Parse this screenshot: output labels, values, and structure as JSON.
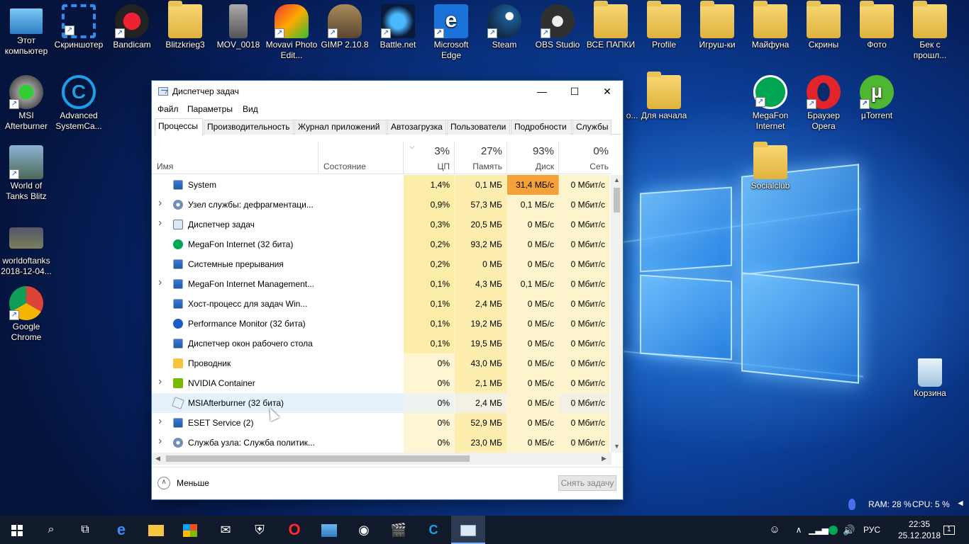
{
  "desktop": {
    "icons_top": [
      {
        "label": "Этот компьютер",
        "icon": "computer-icon"
      },
      {
        "label": "Скриншотер",
        "icon": "screenshot-icon"
      },
      {
        "label": "Bandicam",
        "icon": "bandicam-icon"
      },
      {
        "label": "Blitzkrieg3",
        "icon": "folder-icon"
      },
      {
        "label": "MOV_0018",
        "icon": "video-icon"
      },
      {
        "label": "Movavi Photo Edit...",
        "icon": "movavi-icon"
      },
      {
        "label": "GIMP 2.10.8",
        "icon": "gimp-icon"
      },
      {
        "label": "Battle.net",
        "icon": "battlenet-icon"
      },
      {
        "label": "Microsoft Edge",
        "icon": "edge-icon"
      },
      {
        "label": "Steam",
        "icon": "steam-icon"
      },
      {
        "label": "OBS Studio",
        "icon": "obs-icon"
      },
      {
        "label": "ВСЕ ПАПКИ",
        "icon": "folder-icon"
      },
      {
        "label": "Profile",
        "icon": "folder-icon"
      },
      {
        "label": "Игруш-ки",
        "icon": "folder-icon"
      },
      {
        "label": "Майфуна",
        "icon": "folder-icon"
      },
      {
        "label": "Скрины",
        "icon": "folder-icon"
      },
      {
        "label": "Фото",
        "icon": "folder-icon"
      },
      {
        "label": "Бек с прошл...",
        "icon": "folder-icon"
      }
    ],
    "icons_left": [
      {
        "label": "MSI Afterburner",
        "icon": "msi-afterburner-icon"
      },
      {
        "label": "World of Tanks Blitz",
        "icon": "wot-blitz-icon"
      },
      {
        "label": "worldoftanks 2018-12-04...",
        "icon": "video-icon"
      },
      {
        "label": "Google Chrome",
        "icon": "chrome-icon"
      }
    ],
    "icon_advanced": {
      "label": "Advanced SystemCa...",
      "icon": "advanced-systemcare-icon"
    },
    "icon_partial": {
      "label": "ита о...",
      "icon": "app-icon"
    },
    "icon_dlya_nachala": {
      "label": "Для начала",
      "icon": "folder-icon"
    },
    "icons_right": [
      {
        "label": "MegaFon Internet",
        "icon": "megafon-icon"
      },
      {
        "label": "Браузер Opera",
        "icon": "opera-icon"
      },
      {
        "label": "µTorrent",
        "icon": "utorrent-icon"
      }
    ],
    "icon_socialclub": {
      "label": "Socialclub",
      "icon": "folder-icon"
    },
    "icon_recycle": {
      "label": "Корзина",
      "icon": "recycle-bin-icon"
    }
  },
  "taskmanager": {
    "title": "Диспетчер задач",
    "menu": [
      "Файл",
      "Параметры",
      "Вид"
    ],
    "tabs": [
      "Процессы",
      "Производительность",
      "Журнал приложений",
      "Автозагрузка",
      "Пользователи",
      "Подробности",
      "Службы"
    ],
    "columns": {
      "name": "Имя",
      "status": "Состояние",
      "cpu": {
        "pct": "3%",
        "label": "ЦП"
      },
      "mem": {
        "pct": "27%",
        "label": "Память"
      },
      "disk": {
        "pct": "93%",
        "label": "Диск"
      },
      "net": {
        "pct": "0%",
        "label": "Сеть"
      }
    },
    "rows": [
      {
        "name": "System",
        "expand": false,
        "cpu": "1,4%",
        "mem": "0,1 МБ",
        "disk": "31,4 МБ/с",
        "net": "0 Мбит/с",
        "icon": "system-icon"
      },
      {
        "name": "Узел службы: дефрагментаци...",
        "expand": true,
        "cpu": "0,9%",
        "mem": "57,3 МБ",
        "disk": "0,1 МБ/с",
        "net": "0 Мбит/с",
        "icon": "gear-icon"
      },
      {
        "name": "Диспетчер задач",
        "expand": true,
        "cpu": "0,3%",
        "mem": "20,5 МБ",
        "disk": "0 МБ/с",
        "net": "0 Мбит/с",
        "icon": "taskmgr-icon"
      },
      {
        "name": "MegaFon Internet (32 бита)",
        "expand": false,
        "cpu": "0,2%",
        "mem": "93,2 МБ",
        "disk": "0 МБ/с",
        "net": "0 Мбит/с",
        "icon": "megafon-icon"
      },
      {
        "name": "Системные прерывания",
        "expand": false,
        "cpu": "0,2%",
        "mem": "0 МБ",
        "disk": "0 МБ/с",
        "net": "0 Мбит/с",
        "icon": "system-icon"
      },
      {
        "name": "MegaFon Internet Management...",
        "expand": true,
        "cpu": "0,1%",
        "mem": "4,3 МБ",
        "disk": "0,1 МБ/с",
        "net": "0 Мбит/с",
        "icon": "system-icon"
      },
      {
        "name": "Хост-процесс для задач Win...",
        "expand": false,
        "cpu": "0,1%",
        "mem": "2,4 МБ",
        "disk": "0 МБ/с",
        "net": "0 Мбит/с",
        "icon": "system-icon"
      },
      {
        "name": "Performance Monitor (32 бита)",
        "expand": false,
        "cpu": "0,1%",
        "mem": "19,2 МБ",
        "disk": "0 МБ/с",
        "net": "0 Мбит/с",
        "icon": "performance-icon"
      },
      {
        "name": "Диспетчер окон рабочего стола",
        "expand": false,
        "cpu": "0,1%",
        "mem": "19,5 МБ",
        "disk": "0 МБ/с",
        "net": "0 Мбит/с",
        "icon": "system-icon"
      },
      {
        "name": "Проводник",
        "expand": false,
        "cpu": "0%",
        "mem": "43,0 МБ",
        "disk": "0 МБ/с",
        "net": "0 Мбит/с",
        "icon": "explorer-icon"
      },
      {
        "name": "NVIDIA Container",
        "expand": true,
        "cpu": "0%",
        "mem": "2,1 МБ",
        "disk": "0 МБ/с",
        "net": "0 Мбит/с",
        "icon": "nvidia-icon"
      },
      {
        "name": "MSIAfterburner (32 бита)",
        "expand": false,
        "cpu": "0%",
        "mem": "2,4 МБ",
        "disk": "0 МБ/с",
        "net": "0 Мбит/с",
        "icon": "msi-afterburner-icon"
      },
      {
        "name": "ESET Service (2)",
        "expand": true,
        "cpu": "0%",
        "mem": "52,9 МБ",
        "disk": "0 МБ/с",
        "net": "0 Мбит/с",
        "icon": "system-icon"
      },
      {
        "name": "Служба узла: Служба политик...",
        "expand": true,
        "cpu": "0%",
        "mem": "23,0 МБ",
        "disk": "0 МБ/с",
        "net": "0 Мбит/с",
        "icon": "gear-icon"
      }
    ],
    "footer": {
      "less_label": "Меньше",
      "end_task_label": "Снять задачу"
    }
  },
  "overlay": {
    "ram": "RAM: 28 %",
    "cpu": "CPU: 5 %"
  },
  "taskbar": {
    "items": [
      "start-icon",
      "search-icon",
      "task-view-icon",
      "edge-icon",
      "explorer-icon",
      "store-icon",
      "mail-icon",
      "wot-icon",
      "opera-icon",
      "control-panel-icon",
      "obs-icon",
      "video-editor-icon",
      "advanced-systemcare-icon",
      "taskmgr-icon"
    ],
    "lang": "РУС",
    "time": "22:35",
    "date": "25.12.2018",
    "notifications": "1"
  }
}
